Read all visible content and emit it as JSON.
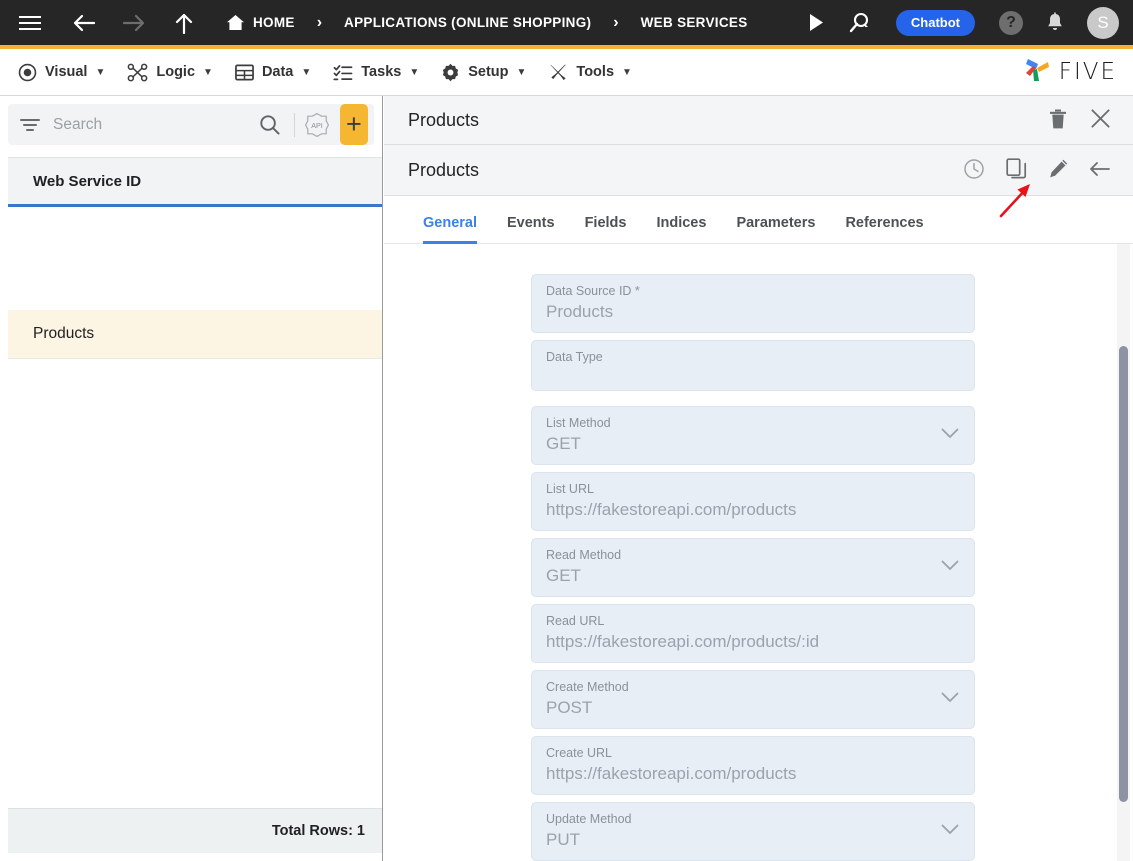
{
  "topbar": {
    "menu_icon": "hamburger-menu-icon",
    "back_icon": "arrow-back-icon",
    "forward_icon": "arrow-forward-icon",
    "up_icon": "arrow-up-icon",
    "home_icon": "home-icon",
    "breadcrumbs": [
      {
        "label": "HOME"
      },
      {
        "label": "APPLICATIONS (ONLINE SHOPPING)"
      },
      {
        "label": "WEB SERVICES"
      }
    ],
    "separator": "›",
    "run_icon": "play-run-icon",
    "search_icon": "search-speech-icon",
    "chatbot_label": "Chatbot",
    "help_label": "?",
    "help_icon": "help-circle-icon",
    "bell_icon": "notification-bell-icon",
    "avatar_initial": "S",
    "accent_color": "#f2b233",
    "chatbot_color": "#2563eb"
  },
  "menubar": {
    "items": [
      {
        "label": "Visual",
        "icon": "eye-icon",
        "caret": "▼"
      },
      {
        "label": "Logic",
        "icon": "logic-nodes-icon",
        "caret": "▼"
      },
      {
        "label": "Data",
        "icon": "table-grid-icon",
        "caret": "▼"
      },
      {
        "label": "Tasks",
        "icon": "checklist-icon",
        "caret": "▼"
      },
      {
        "label": "Setup",
        "icon": "gear-icon",
        "caret": "▼"
      },
      {
        "label": "Tools",
        "icon": "tools-wrench-icon",
        "caret": "▼"
      }
    ],
    "brand": "FIVE"
  },
  "sidebar": {
    "search": {
      "placeholder": "Search",
      "value": "",
      "filter_icon": "filter-icon",
      "search_icon": "search-icon"
    },
    "api_button_label": "API",
    "add_button_label": "+",
    "add_button_color": "#f5b731",
    "column_header": "Web Service ID",
    "rows": [
      {
        "label": "Products",
        "selected": true
      }
    ],
    "footer": "Total Rows: 1"
  },
  "detail": {
    "header_title": "Products",
    "header_actions": [
      {
        "name": "delete-button",
        "icon": "trash-icon"
      },
      {
        "name": "close-button",
        "icon": "close-icon"
      }
    ],
    "sub_title": "Products",
    "sub_actions": [
      {
        "name": "history-button",
        "icon": "history-clock-icon"
      },
      {
        "name": "duplicate-button",
        "icon": "copy-icon"
      },
      {
        "name": "edit-button",
        "icon": "pencil-edit-icon"
      },
      {
        "name": "back-button",
        "icon": "arrow-left-icon"
      }
    ],
    "tabs": [
      {
        "label": "General",
        "active": true
      },
      {
        "label": "Events",
        "active": false
      },
      {
        "label": "Fields",
        "active": false
      },
      {
        "label": "Indices",
        "active": false
      },
      {
        "label": "Parameters",
        "active": false
      },
      {
        "label": "References",
        "active": false
      }
    ],
    "active_tab_color": "#3b82e8",
    "fields": [
      {
        "label": "Data Source ID *",
        "value": "Products",
        "type": "text"
      },
      {
        "label": "Data Type",
        "value": "",
        "type": "text"
      },
      {
        "label": "List Method",
        "value": "GET",
        "type": "select"
      },
      {
        "label": "List URL",
        "value": "https://fakestoreapi.com/products",
        "type": "text"
      },
      {
        "label": "Read Method",
        "value": "GET",
        "type": "select"
      },
      {
        "label": "Read URL",
        "value": "https://fakestoreapi.com/products/:id",
        "type": "text"
      },
      {
        "label": "Create Method",
        "value": "POST",
        "type": "select"
      },
      {
        "label": "Create URL",
        "value": "https://fakestoreapi.com/products",
        "type": "text"
      },
      {
        "label": "Update Method",
        "value": "PUT",
        "type": "select"
      }
    ]
  },
  "annotation": {
    "arrow_color": "#e8131a",
    "target": "edit-button"
  }
}
